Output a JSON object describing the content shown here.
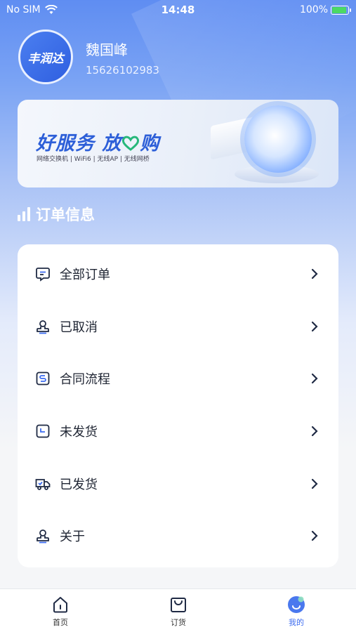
{
  "status_bar": {
    "carrier": "No SIM",
    "time": "14:48",
    "battery": "100%"
  },
  "profile": {
    "avatar_text": "丰润达",
    "name": "魏国峰",
    "phone": "15626102983"
  },
  "banner": {
    "title_part1": "好服务 放",
    "title_part2": "购",
    "subtitle": "网络交换机 | WiFi6 | 无线AP | 无线网桥"
  },
  "section": {
    "title": "订单信息"
  },
  "menu": {
    "items": [
      {
        "label": "全部订单",
        "icon": "message-square-icon"
      },
      {
        "label": "已取消",
        "icon": "stamp-icon"
      },
      {
        "label": "合同流程",
        "icon": "contract-s-icon"
      },
      {
        "label": "未发货",
        "icon": "clock-icon"
      },
      {
        "label": "已发货",
        "icon": "truck-icon"
      },
      {
        "label": "关于",
        "icon": "stamp-icon"
      }
    ]
  },
  "tabbar": {
    "tabs": [
      {
        "label": "首页",
        "icon": "home-icon"
      },
      {
        "label": "订货",
        "icon": "shopping-bag-icon"
      },
      {
        "label": "我的",
        "icon": "profile-icon"
      }
    ],
    "active_color": "#3d6cf0"
  },
  "colors": {
    "primary": "#3d6cf0",
    "accent_green": "#27b87a"
  }
}
